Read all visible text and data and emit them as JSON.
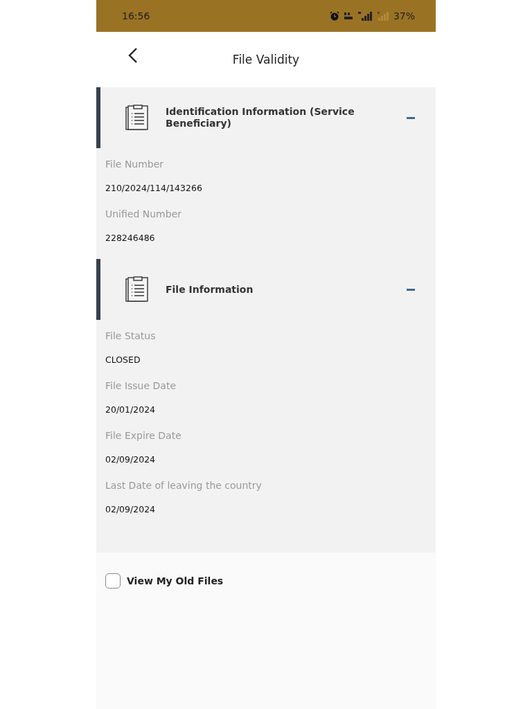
{
  "status_bar": {
    "time": "16:56",
    "battery": "37%"
  },
  "header": {
    "title": "File Validity"
  },
  "sections": [
    {
      "title": "Identification Information (Service Beneficiary)",
      "expanded": true,
      "fields": [
        {
          "label": "File Number",
          "value": "210/2024/114/143266"
        },
        {
          "label": "Unified Number",
          "value": "228246486"
        }
      ]
    },
    {
      "title": "File Information",
      "expanded": true,
      "fields": [
        {
          "label": "File Status",
          "value": "CLOSED"
        },
        {
          "label": "File Issue Date",
          "value": "20/01/2024"
        },
        {
          "label": "File Expire Date",
          "value": "02/09/2024"
        },
        {
          "label": "Last Date of leaving the country",
          "value": "02/09/2024"
        }
      ]
    }
  ],
  "old_files": {
    "label": "View My Old Files",
    "checked": false
  }
}
